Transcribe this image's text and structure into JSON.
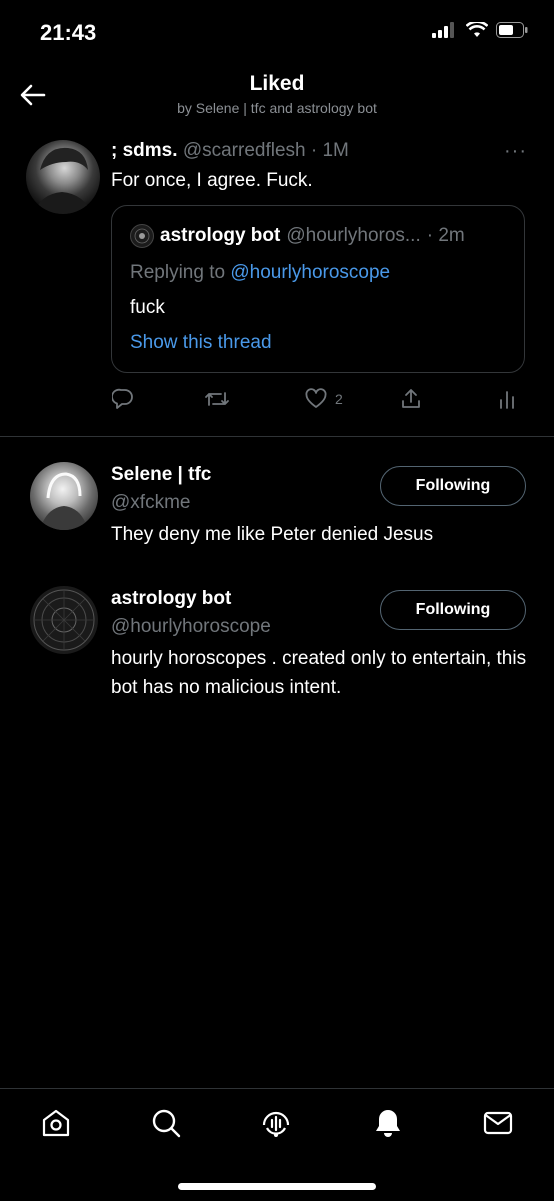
{
  "status_bar": {
    "time": "21:43"
  },
  "header": {
    "title": "Liked",
    "subtitle": "by Selene | tfc and astrology bot"
  },
  "tweet": {
    "name": "; sdms.",
    "handle": "@scarredflesh",
    "time": "· 1M",
    "text": "For once, I agree. Fuck.",
    "quote": {
      "name": "astrology bot",
      "handle": "@hourlyhoros...",
      "time": "· 2m",
      "replying_prefix": "Replying to",
      "replying_handle": "@hourlyhoroscope",
      "text": "fuck",
      "show_thread": "Show this thread"
    },
    "like_count": "2"
  },
  "users": [
    {
      "name": "Selene | tfc",
      "handle": "@xfckme",
      "bio": "They deny me like Peter denied Jesus",
      "button": "Following"
    },
    {
      "name": "astrology bot",
      "handle": "@hourlyhoroscope",
      "bio": "hourly horoscopes . created only to entertain, this bot has no malicious intent.",
      "button": "Following"
    }
  ],
  "tabs": [
    "home-icon",
    "search-icon",
    "spaces-icon",
    "notifications-icon",
    "messages-icon"
  ],
  "colors": {
    "background": "#000000",
    "link": "#4a99e9",
    "muted": "#71767b",
    "border": "#2f3336"
  }
}
